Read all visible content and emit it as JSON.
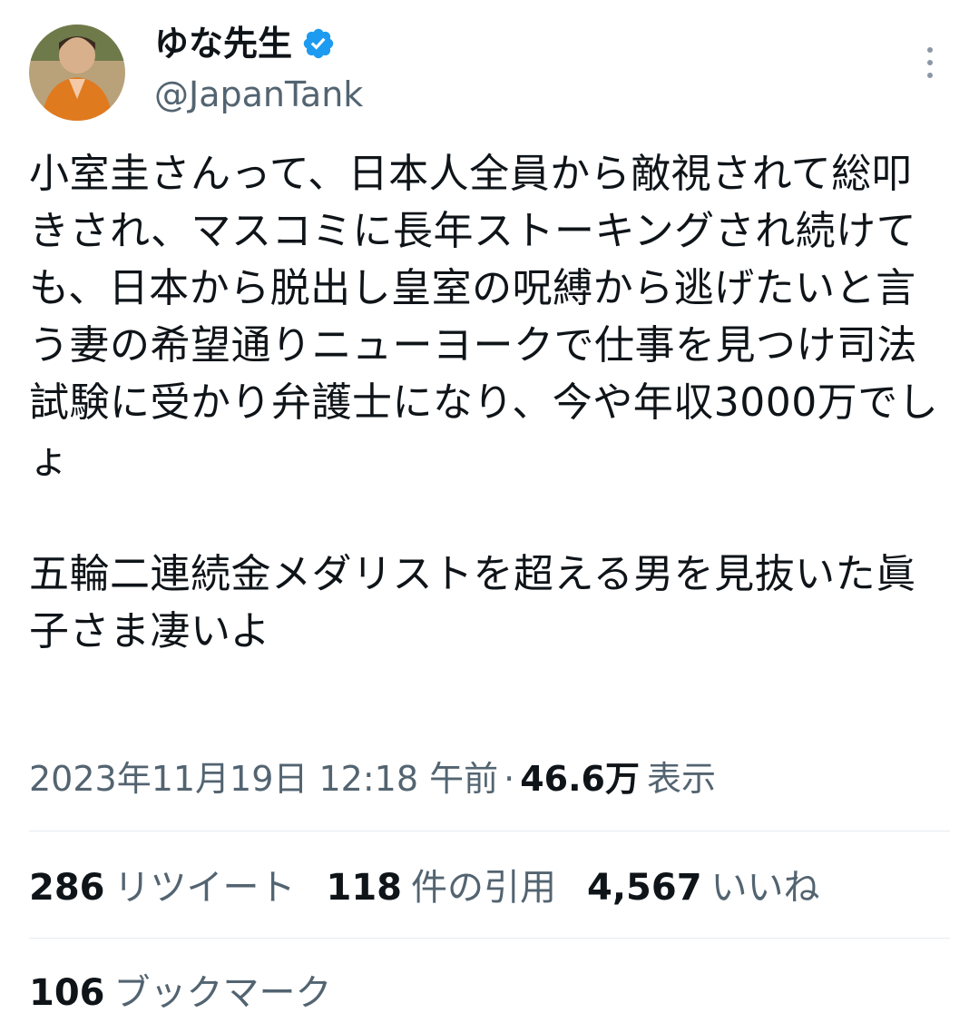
{
  "author": {
    "display_name": "ゆな先生",
    "handle": "@JapanTank",
    "verified": true,
    "avatar_icon": "profile-photo"
  },
  "tweet": {
    "text": "小室圭さんって、日本人全員から敵視されて総叩きされ、マスコミに長年ストーキングされ続けても、日本から脱出し皇室の呪縛から逃げたいと言う妻の希望通りニューヨークで仕事を見つけ司法試験に受かり弁護士になり、今や年収3000万でしょ\n\n五輪二連続金メダリストを超える男を見抜いた眞子さま凄いよ",
    "timestamp": "2023年11月19日 12:18 午前",
    "separator": "·",
    "views_count": "46.6万",
    "views_label": "表示"
  },
  "stats": {
    "retweets_count": "286",
    "retweets_label": "リツイート",
    "quotes_count": "118",
    "quotes_label": "件の引用",
    "likes_count": "4,567",
    "likes_label": "いいね",
    "bookmarks_count": "106",
    "bookmarks_label": "ブックマーク"
  },
  "colors": {
    "text_primary": "#0f1419",
    "text_secondary": "#536471",
    "verified_blue": "#1d9bf0",
    "divider": "#e6ecf0"
  }
}
